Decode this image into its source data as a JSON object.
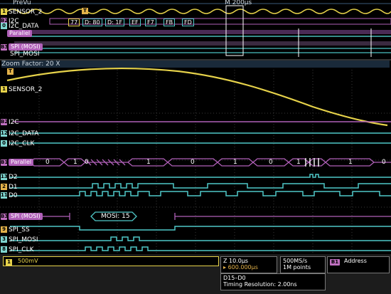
{
  "header": {
    "prevu_label": "PreVu",
    "timebase_label": "M 200µs",
    "zoom_factor": "Zoom Factor: 20 X"
  },
  "overview": {
    "channels": [
      {
        "marker": "1",
        "label": "SENSOR_2"
      },
      {
        "marker": "B2",
        "label": "I2C"
      },
      {
        "marker": "0",
        "label": "I2C_DATA"
      },
      {
        "marker": "B1",
        "label": "Parallel"
      },
      {
        "marker": "B3",
        "label": "SPI (MOSI)"
      },
      {
        "marker": "3",
        "label": "SPI_MOSI"
      }
    ],
    "decode_packets": [
      "77",
      "D: 80",
      "D: 1F",
      "EF",
      "F7",
      "FB",
      "FD"
    ]
  },
  "zoom": {
    "channels": {
      "sensor": {
        "marker": "1",
        "label": "SENSOR_2"
      },
      "i2c_bus": {
        "marker": "B2",
        "label": "I2C"
      },
      "i2c_data": {
        "marker": "12",
        "label": "I2C_DATA"
      },
      "i2c_clk": {
        "marker": "0",
        "label": "I2C_CLK"
      },
      "parallel_bus": {
        "marker": "B1",
        "label": "Parallel"
      },
      "d2": {
        "marker": "13",
        "label": "D2"
      },
      "d1": {
        "marker": "2",
        "label": "D1"
      },
      "d0": {
        "marker": "11",
        "label": "D0"
      },
      "spi_bus": {
        "marker": "B3",
        "label": "SPI (MOSI)"
      },
      "spi_ss": {
        "marker": "9",
        "label": "SPI_SS"
      },
      "spi_mosi": {
        "marker": "3",
        "label": "SPI_MOSI"
      },
      "spi_clk": {
        "marker": "8",
        "label": "SPI_CLK"
      }
    },
    "parallel_values": [
      "0",
      "1",
      "0",
      "1",
      "0",
      "1",
      "0",
      "1",
      "0",
      "1",
      "0",
      "1"
    ],
    "spi_decode": "MOSI: 15"
  },
  "status": {
    "ch1_marker": "1",
    "ch1_scale": "500mV",
    "horizontal_scale": "Z 10.0µs",
    "horizontal_position": "600.000µs",
    "sample_rate": "500MS/s",
    "record_length": "1M points",
    "bus_marker": "B1",
    "trigger_label": "Address",
    "digital_range": "D15–D0",
    "timing_resolution": "Timing Resolution: 2.00ns"
  },
  "colors": {
    "analog": "#e6d24a",
    "digital": "#4fc8c8",
    "bus": "#b060b8"
  }
}
